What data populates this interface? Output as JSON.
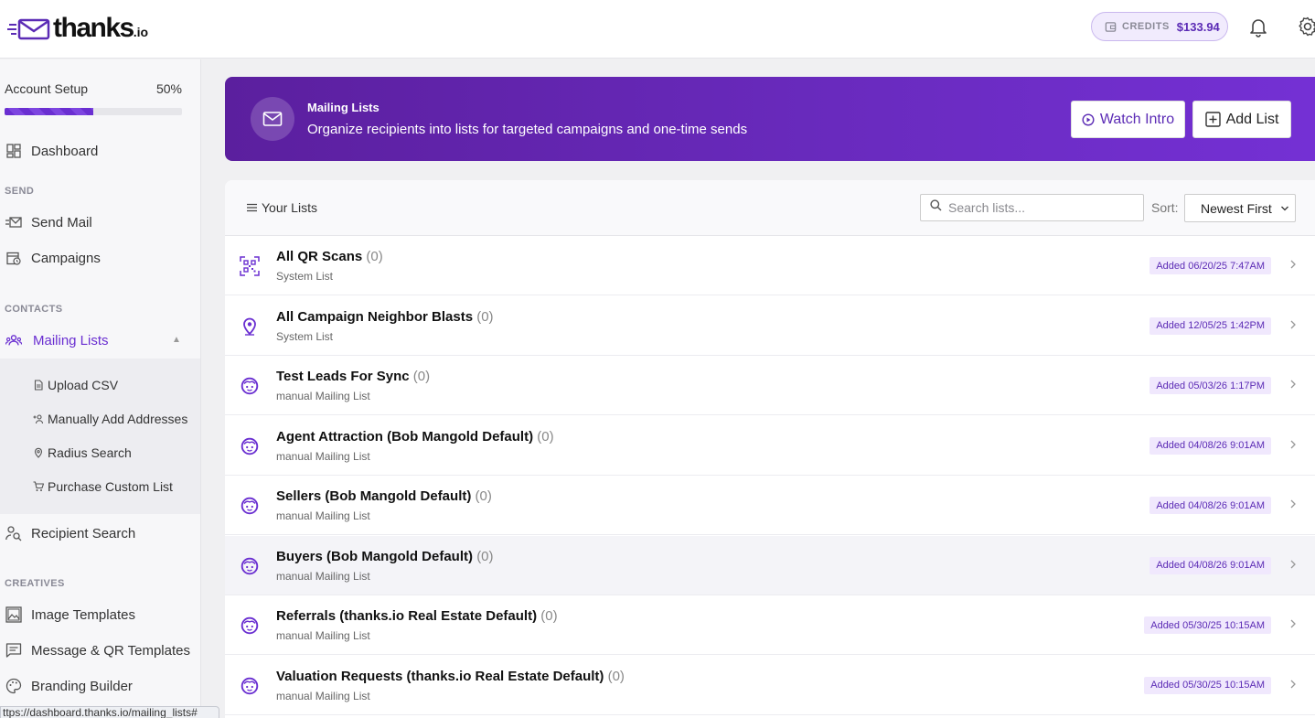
{
  "header": {
    "logo_text": "thanks",
    "logo_suffix": ".io",
    "credits_label": "CREDITS",
    "credits_amount": "$133.94"
  },
  "sidebar": {
    "setup_label": "Account Setup",
    "setup_percent": "50%",
    "setup_progress": 0.5,
    "dashboard": "Dashboard",
    "section_send": "SEND",
    "send_mail": "Send Mail",
    "campaigns": "Campaigns",
    "section_contacts": "CONTACTS",
    "mailing_lists": "Mailing Lists",
    "sub_items": [
      "Upload CSV",
      "Manually Add Addresses",
      "Radius Search",
      "Purchase Custom List"
    ],
    "recipient_search": "Recipient Search",
    "section_creatives": "CREATIVES",
    "image_templates": "Image Templates",
    "message_qr_templates": "Message & QR Templates",
    "branding_builder": "Branding Builder"
  },
  "status_url": "ttps://dashboard.thanks.io/mailing_lists#",
  "banner": {
    "title": "Mailing Lists",
    "subtitle": "Organize recipients into lists for targeted campaigns and one-time sends",
    "watch_intro": "Watch Intro",
    "add_list": "Add List"
  },
  "lists_panel": {
    "title": "Your Lists",
    "search_placeholder": "Search lists...",
    "sort_label": "Sort:",
    "sort_value": "Newest First"
  },
  "lists": [
    {
      "name": "All QR Scans",
      "count": "(0)",
      "type": "System List",
      "date": "Added 06/20/25 7:47AM",
      "icon": "qr-code-icon"
    },
    {
      "name": "All Campaign Neighbor Blasts",
      "count": "(0)",
      "type": "System List",
      "date": "Added 12/05/25 1:42PM",
      "icon": "map-pin-icon"
    },
    {
      "name": "Test Leads For Sync",
      "count": "(0)",
      "type": "manual Mailing List",
      "date": "Added 05/03/26 1:17PM",
      "icon": "face-icon"
    },
    {
      "name": "Agent Attraction (Bob Mangold Default)",
      "count": "(0)",
      "type": "manual Mailing List",
      "date": "Added 04/08/26 9:01AM",
      "icon": "face-icon"
    },
    {
      "name": "Sellers (Bob Mangold Default)",
      "count": "(0)",
      "type": "manual Mailing List",
      "date": "Added 04/08/26 9:01AM",
      "icon": "face-icon"
    },
    {
      "name": "Buyers (Bob Mangold Default)",
      "count": "(0)",
      "type": "manual Mailing List",
      "date": "Added 04/08/26 9:01AM",
      "icon": "face-icon"
    },
    {
      "name": "Referrals (thanks.io Real Estate Default)",
      "count": "(0)",
      "type": "manual Mailing List",
      "date": "Added 05/30/25 10:15AM",
      "icon": "face-icon"
    },
    {
      "name": "Valuation Requests (thanks.io Real Estate Default)",
      "count": "(0)",
      "type": "manual Mailing List",
      "date": "Added 05/30/25 10:15AM",
      "icon": "face-icon"
    }
  ],
  "colors": {
    "brand_purple": "#6a2fd1",
    "date_badge_bg": "#f0e8fd"
  }
}
